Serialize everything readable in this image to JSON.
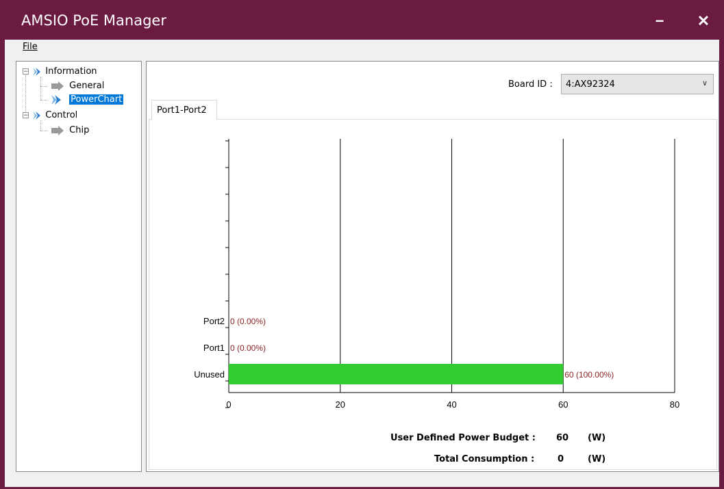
{
  "window": {
    "title": "AMSIO PoE Manager",
    "minimize_label": "−",
    "close_label": "✕",
    "accent_color": "#6b1b3f"
  },
  "menu": {
    "file": "File"
  },
  "tree": {
    "nodes": [
      {
        "label": "Information",
        "expanded": true,
        "children": [
          "General",
          "PowerChart"
        ]
      },
      {
        "label": "Control",
        "expanded": true,
        "children": [
          "Chip"
        ]
      }
    ],
    "selected": "PowerChart"
  },
  "board": {
    "label": "Board ID :",
    "selected": "4:AX92324"
  },
  "tabs": [
    {
      "label": "Port1-Port2",
      "active": true
    }
  ],
  "chart_data": {
    "type": "bar",
    "orientation": "horizontal",
    "categories": [
      "Port2",
      "Port1",
      "Unused"
    ],
    "values": [
      0,
      0,
      60
    ],
    "data_labels": [
      "0  (0.00%)",
      "0  (0.00%)",
      "60  (100.00%)"
    ],
    "xlim": [
      0,
      80
    ],
    "xticks": [
      "0",
      "20",
      "40",
      "60",
      "80"
    ],
    "grid": "vertical",
    "bar_color": "#33cc33",
    "label_color": "#8b2323"
  },
  "budget": {
    "budget_label": "User Defined Power Budget :",
    "budget_value": "60",
    "budget_unit": "(W)",
    "consumption_label": "Total Consumption :",
    "consumption_value": "0",
    "consumption_unit": "(W)"
  }
}
